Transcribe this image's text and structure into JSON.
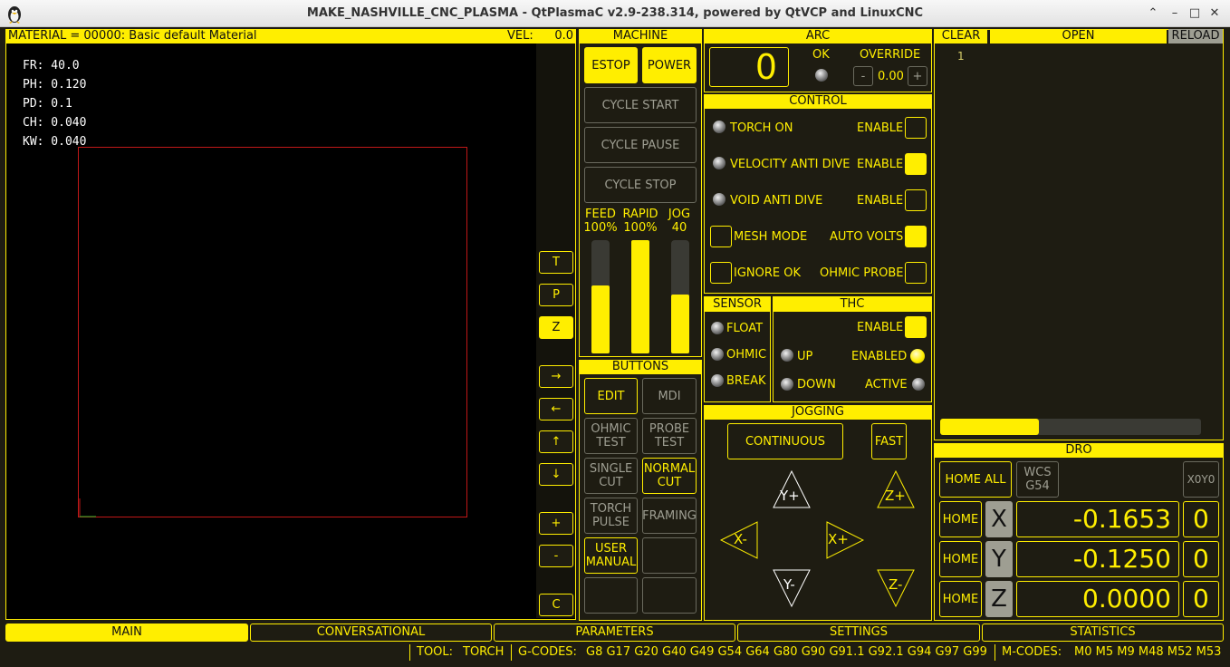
{
  "window": {
    "title": "MAKE_NASHVILLE_CNC_PLASMA - QtPlasmaC v2.9-238.314, powered by QtVCP and LinuxCNC",
    "minimize": "–",
    "restore": "▭",
    "maximize": "□",
    "close": "✕",
    "collapse": "⌃"
  },
  "preview": {
    "material": "MATERIAL =  00000: Basic default Material",
    "vel_label": "VEL:",
    "vel_value": "0.0",
    "params": [
      "FR: 40.0",
      "PH: 0.120",
      "PD: 0.1",
      "CH: 0.040",
      "KW: 0.040"
    ],
    "view_buttons": [
      "T",
      "P",
      "Z"
    ],
    "pan_buttons": [
      "→",
      "←",
      "↑",
      "↓"
    ],
    "zoom_buttons": [
      "+",
      "-"
    ],
    "clear_button": "C"
  },
  "machine": {
    "header": "MACHINE",
    "estop": "ESTOP",
    "power": "POWER",
    "cycle_start": "CYCLE START",
    "cycle_pause": "CYCLE PAUSE",
    "cycle_stop": "CYCLE STOP",
    "feed_label": "FEED",
    "feed_value": "100%",
    "feed_level": 0.6,
    "rapid_label": "RAPID",
    "rapid_value": "100%",
    "rapid_level": 1.0,
    "jog_label": "JOG",
    "jog_value": "40",
    "jog_level": 0.52
  },
  "buttons": {
    "header": "BUTTONS",
    "edit": "EDIT",
    "mdi": "MDI",
    "ohmic_test": "OHMIC TEST",
    "probe_test": "PROBE TEST",
    "single_cut": "SINGLE CUT",
    "normal_cut": "NORMAL CUT",
    "torch_pulse": "TORCH PULSE",
    "framing": "FRAMING",
    "user_manual": "USER MANUAL"
  },
  "arc": {
    "header": "ARC",
    "voltage": "0",
    "ok_label": "OK",
    "override_label": "OVERRIDE",
    "override_minus": "-",
    "override_value": "0.00",
    "override_plus": "+"
  },
  "control": {
    "header": "CONTROL",
    "torch_on": "TORCH ON",
    "vel_anti_dive": "VELOCITY ANTI DIVE",
    "void_anti_dive": "VOID ANTI DIVE",
    "enable": "ENABLE",
    "mesh_mode": "MESH MODE",
    "auto_volts": "AUTO VOLTS",
    "ignore_ok": "IGNORE OK",
    "ohmic_probe": "OHMIC PROBE"
  },
  "sensor": {
    "header": "SENSOR",
    "float": "FLOAT",
    "ohmic": "OHMIC",
    "break": "BREAK"
  },
  "thc": {
    "header": "THC",
    "enable": "ENABLE",
    "up": "UP",
    "enabled": "ENABLED",
    "down": "DOWN",
    "active": "ACTIVE"
  },
  "jogging": {
    "header": "JOGGING",
    "continuous": "CONTINUOUS",
    "fast": "FAST",
    "y_plus": "Y+",
    "y_minus": "Y-",
    "x_plus": "X+",
    "x_minus": "X-",
    "z_plus": "Z+",
    "z_minus": "Z-"
  },
  "file": {
    "clear": "CLEAR",
    "open": "OPEN",
    "reload": "RELOAD",
    "line_number": "1",
    "progress": 0.38
  },
  "dro": {
    "header": "DRO",
    "home_all": "HOME ALL",
    "wcs": "WCS",
    "wcs_value": "G54",
    "x0y0": "X0Y0",
    "home": "HOME",
    "axes": [
      {
        "name": "X",
        "value": "-0.1653",
        "zero": "0"
      },
      {
        "name": "Y",
        "value": "-0.1250",
        "zero": "0"
      },
      {
        "name": "Z",
        "value": "0.0000",
        "zero": "0"
      }
    ]
  },
  "tabs": [
    "MAIN",
    "CONVERSATIONAL",
    "PARAMETERS",
    "SETTINGS",
    "STATISTICS"
  ],
  "status": {
    "tool_label": "TOOL:",
    "tool": "TORCH",
    "gcodes_label": "G-CODES:",
    "gcodes": "G8 G17 G20 G40 G49 G54 G64 G80 G90 G91.1 G92.1 G94 G97 G99",
    "mcodes_label": "M-CODES:",
    "mcodes": "M0 M5 M9 M48 M52 M53"
  },
  "colors": {
    "accent": "#ffee00",
    "background": "#1e1c12",
    "preview_bg": "#000000",
    "limit_box": "#c01818"
  }
}
